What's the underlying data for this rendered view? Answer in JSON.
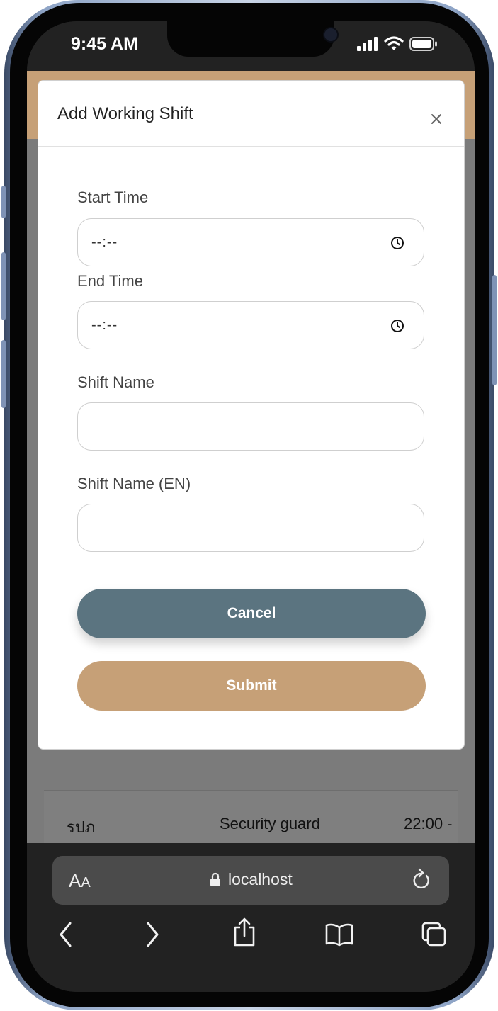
{
  "status_bar": {
    "time": "9:45 AM"
  },
  "modal": {
    "title": "Add Working Shift",
    "close_icon": "close-icon",
    "fields": [
      {
        "label": "Start Time",
        "value": "--:--",
        "type": "time"
      },
      {
        "label": "End Time",
        "value": "--:--",
        "type": "time"
      },
      {
        "label": "Shift Name",
        "value": "",
        "type": "text"
      },
      {
        "label": "Shift Name (EN)",
        "value": "",
        "type": "text"
      }
    ],
    "cancel_label": "Cancel",
    "submit_label": "Submit"
  },
  "background_table": {
    "row": [
      "รปภ",
      "Security guard",
      "22:00 -"
    ]
  },
  "browser": {
    "text_size_label_big": "A",
    "text_size_label_small": "A",
    "url": "localhost"
  },
  "colors": {
    "accent_tan": "#c6a077",
    "cancel_slate": "#5b7480",
    "overlay_gray": "#7b7b7b"
  }
}
